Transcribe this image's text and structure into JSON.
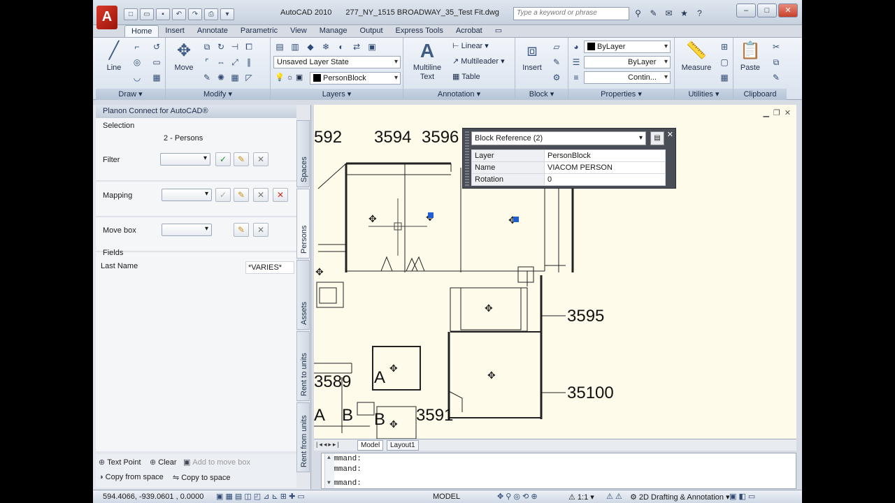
{
  "titlebar": {
    "app_name": "AutoCAD 2010",
    "document": "277_NY_1515 BROADWAY_35_Test Fit.dwg",
    "search_placeholder": "Type a keyword or phrase"
  },
  "ribbon": {
    "tabs": [
      "Home",
      "Insert",
      "Annotate",
      "Parametric",
      "View",
      "Manage",
      "Output",
      "Express Tools",
      "Acrobat"
    ],
    "panels": {
      "draw": "Draw",
      "modify": "Modify",
      "layers": "Layers",
      "annotation": "Annotation",
      "block": "Block",
      "properties": "Properties",
      "utilities": "Utilities",
      "clipboard": "Clipboard"
    },
    "buttons": {
      "line": "Line",
      "move": "Move",
      "multiline_text": "Multiline Text",
      "insert": "Insert",
      "measure": "Measure",
      "paste": "Paste",
      "linear": "Linear",
      "multileader": "Multileader",
      "table": "Table"
    },
    "layer_state": "Unsaved Layer State",
    "current_layer": "PersonBlock",
    "prop_color": "ByLayer",
    "prop_linetype": "ByLayer",
    "prop_lineweight": "Contin..."
  },
  "palette": {
    "title": "Planon Connect for AutoCAD®",
    "selection_label": "Selection",
    "selection_value": "2 - Persons",
    "filter_label": "Filter",
    "mapping_label": "Mapping",
    "movebox_label": "Move box",
    "fields_label": "Fields",
    "lastname_label": "Last Name",
    "lastname_value": "*VARIES*",
    "vtabs": [
      "Spaces",
      "Persons",
      "Assets",
      "Rent to units",
      "Rent from units"
    ],
    "bottom": {
      "text_point": "Text Point",
      "clear": "Clear",
      "add_to_move_box": "Add to move box",
      "copy_from_space": "Copy from space",
      "copy_to_space": "Copy to space"
    }
  },
  "drawing": {
    "labels": [
      "592",
      "3594",
      "3596",
      "3595",
      "35100",
      "3589",
      "3591",
      "A",
      "A",
      "B",
      "B"
    ],
    "layout_tabs": [
      "Model",
      "Layout1"
    ]
  },
  "block_props": {
    "header": "Block Reference (2)",
    "rows": [
      {
        "key": "Layer",
        "value": "PersonBlock"
      },
      {
        "key": "Name",
        "value": "VIACOM PERSON"
      },
      {
        "key": "Rotation",
        "value": "0"
      }
    ]
  },
  "command": {
    "lines": [
      "Command:",
      "Command:",
      "Command:"
    ]
  },
  "status": {
    "coords": "594.4066, -939.0601 , 0.0000",
    "model": "MODEL",
    "scale": "1:1",
    "workspace": "2D Drafting & Annotation"
  }
}
